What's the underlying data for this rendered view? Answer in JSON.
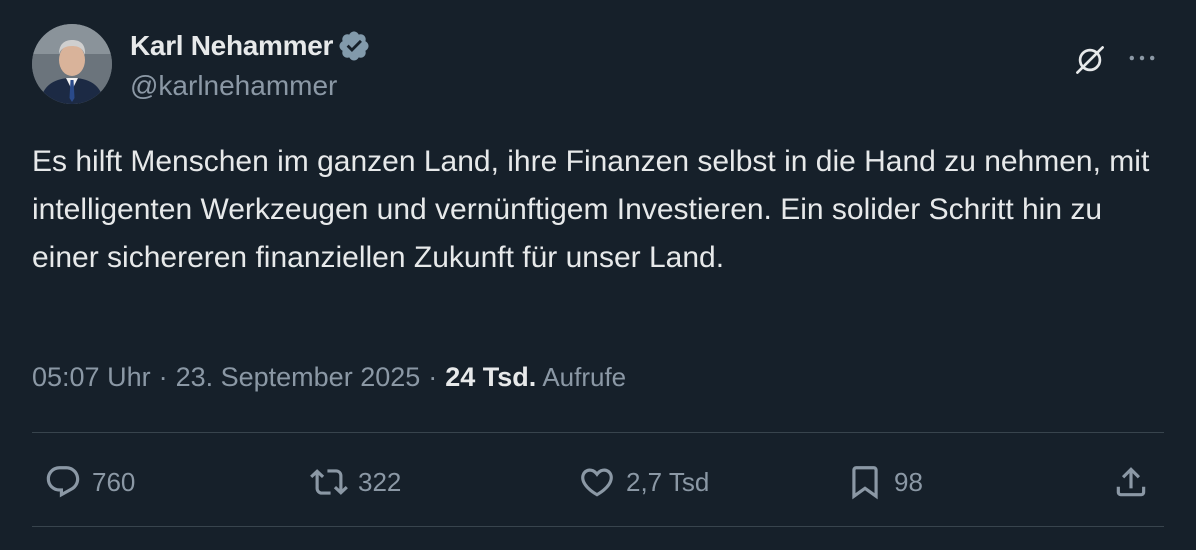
{
  "author": {
    "display_name": "Karl Nehammer",
    "handle": "@karlnehammer",
    "verified": true
  },
  "tweet": {
    "text": "Es hilft Menschen im ganzen Land, ihre Finanzen selbst in die Hand zu nehmen, mit intelligenten Werkzeugen und vernünftigem Investieren. Ein solider Schritt hin zu einer sichereren finanziellen Zukunft für unser Land.",
    "time": "05:07 Uhr",
    "separator": "·",
    "date": "23. September 2025",
    "views_count": "24 Tsd.",
    "views_label": "Aufrufe"
  },
  "actions": {
    "replies": "760",
    "reposts": "322",
    "likes": "2,7 Tsd",
    "bookmarks": "98"
  },
  "icons": {
    "verified": "verified-badge-icon",
    "grok": "grok-icon",
    "more": "more-icon",
    "reply": "reply-icon",
    "repost": "repost-icon",
    "like": "heart-icon",
    "bookmark": "bookmark-icon",
    "share": "share-icon"
  },
  "colors": {
    "background": "#16202a",
    "text_primary": "#e7e9ea",
    "text_secondary": "#8b98a5",
    "divider": "#38444d",
    "verified_badge": "#829aab"
  }
}
